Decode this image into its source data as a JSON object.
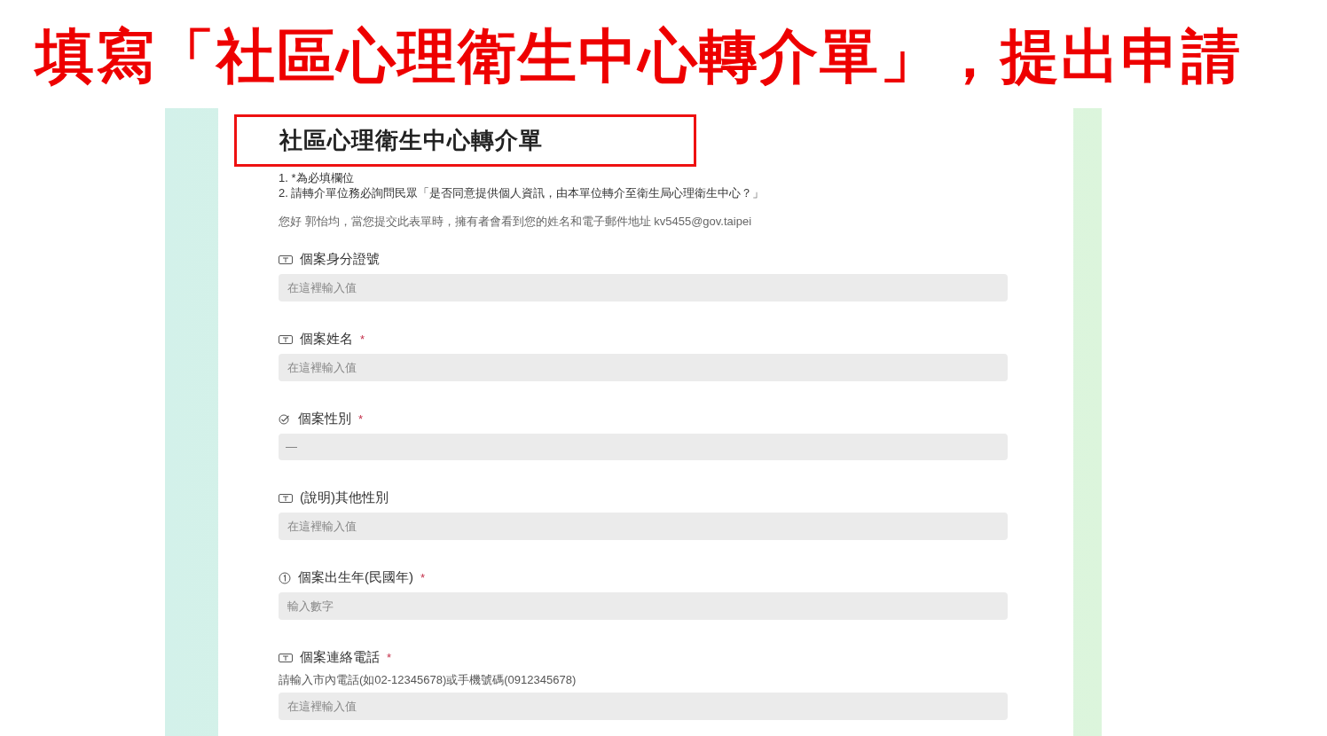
{
  "slide_title": "填寫「社區心理衛生中心轉介單」，提出申請",
  "form": {
    "title": "社區心理衛生中心轉介單",
    "title_highlighted": true,
    "notes": [
      "1. *為必填欄位",
      "2. 請轉介單位務必詢問民眾「是否同意提供個人資訊，由本單位轉介至衛生局心理衛生中心？」"
    ],
    "greeting": "您好 郭怡均，當您提交此表單時，擁有者會看到您的姓名和電子郵件地址 kv5455@gov.taipei",
    "questions": [
      {
        "kind": "text",
        "label": "個案身分證號",
        "placeholder": "在這裡輸入值"
      },
      {
        "kind": "text",
        "label": "個案姓名",
        "required_mark": "*",
        "placeholder": "在這裡輸入值"
      },
      {
        "kind": "choice",
        "label": "個案性別",
        "required_mark": "*",
        "value": "—"
      },
      {
        "kind": "text",
        "label": "(說明)其他性別",
        "placeholder": "在這裡輸入值"
      },
      {
        "kind": "number",
        "label": "個案出生年(民國年)",
        "required_mark": "*",
        "placeholder": "輸入數字"
      },
      {
        "kind": "text",
        "label": "個案連絡電話",
        "required_mark": "*",
        "hint": "請輸入市內電話(如02-12345678)或手機號碼(0912345678)",
        "placeholder": "在這裡輸入值"
      }
    ]
  }
}
